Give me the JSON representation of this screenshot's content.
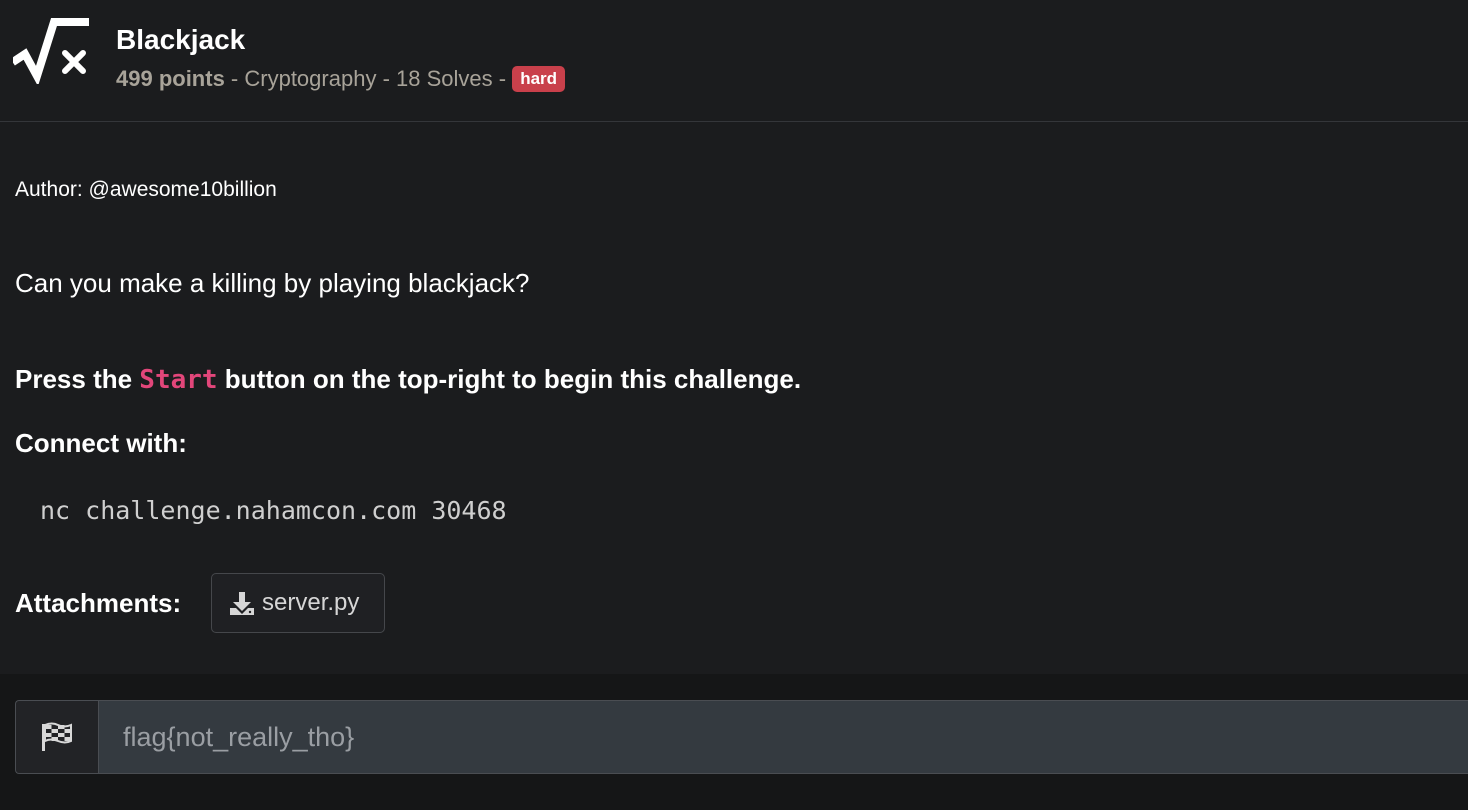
{
  "challenge": {
    "title": "Blackjack",
    "points": "499 points",
    "sep1": " - ",
    "category": "Cryptography",
    "sep2": " - ",
    "solves": "18 Solves",
    "sep3": " - ",
    "difficulty": "hard",
    "logo_icon": "square-root-x-icon"
  },
  "description": {
    "author": "Author: @awesome10billion",
    "question": "Can you make a killing by playing blackjack?",
    "press_prefix": "Press the ",
    "press_code": "Start",
    "press_suffix": " button on the top-right to begin this challenge.",
    "connect_label": "Connect with:",
    "connect_command": "nc challenge.nahamcon.com 30468"
  },
  "attachments": {
    "label": "Attachments:",
    "files": [
      {
        "name": "server.py",
        "icon": "download-icon"
      }
    ]
  },
  "flag_form": {
    "icon": "checkered-flag-icon",
    "placeholder": "flag{not_really_tho}",
    "value": ""
  },
  "colors": {
    "background": "#1b1c1e",
    "badge_hard": "#c9404b",
    "code_accent": "#e2467a",
    "muted_text": "#a8a399"
  }
}
